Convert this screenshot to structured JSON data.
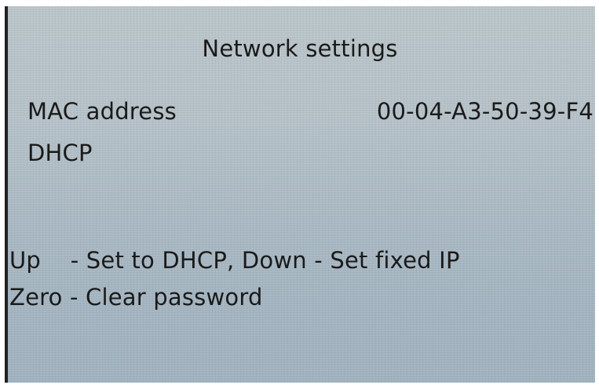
{
  "screen": {
    "title": "Network settings",
    "mac": {
      "label": "MAC address",
      "value": "00-04-A3-50-39-F4"
    },
    "dhcp_label": "DHCP",
    "hints": {
      "line1": "Up    - Set to DHCP, Down - Set fixed IP",
      "line2": "Zero - Clear password"
    }
  }
}
